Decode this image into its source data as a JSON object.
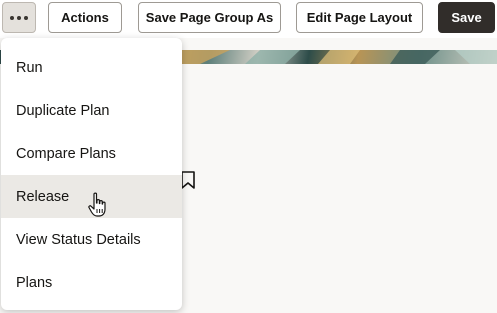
{
  "toolbar": {
    "more_icon": "ellipsis-icon",
    "actions_label": "Actions",
    "save_page_group_label": "Save Page Group As",
    "edit_page_layout_label": "Edit Page Layout",
    "save_label": "Save"
  },
  "menu": {
    "items": [
      {
        "label": "Run"
      },
      {
        "label": "Duplicate Plan"
      },
      {
        "label": "Compare Plans"
      },
      {
        "label": "Release"
      },
      {
        "label": "View Status Details"
      },
      {
        "label": "Plans"
      }
    ],
    "hovered_item": "Release"
  },
  "icons": {
    "bookmark": "bookmark-icon",
    "cursor": "hand-pointer-cursor"
  },
  "colors": {
    "primary_button": "#312d2a",
    "page_background": "#f9f8f6",
    "menu_hover": "#ebe9e5"
  }
}
